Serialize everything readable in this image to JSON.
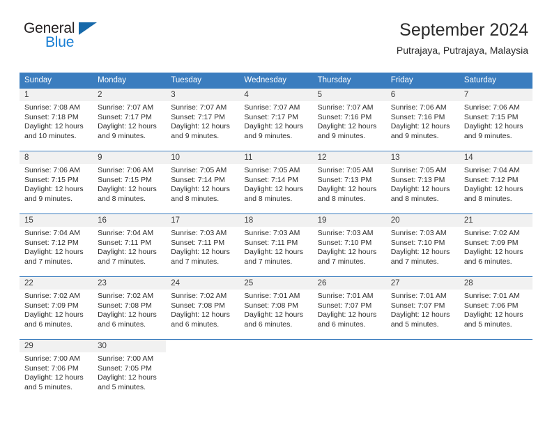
{
  "brand": {
    "name_dark": "General",
    "name_blue": "Blue",
    "accent_blue": "#1a7fd4",
    "triangle_blue": "#1769aa"
  },
  "header": {
    "title": "September 2024",
    "location": "Putrajaya, Putrajaya, Malaysia",
    "header_bg": "#3b7dbf",
    "daynum_bg": "#f1f1f1"
  },
  "weekday_headers": [
    "Sunday",
    "Monday",
    "Tuesday",
    "Wednesday",
    "Thursday",
    "Friday",
    "Saturday"
  ],
  "weeks": [
    {
      "days": [
        {
          "num": "1",
          "sunrise": "Sunrise: 7:08 AM",
          "sunset": "Sunset: 7:18 PM",
          "daylight1": "Daylight: 12 hours",
          "daylight2": "and 10 minutes."
        },
        {
          "num": "2",
          "sunrise": "Sunrise: 7:07 AM",
          "sunset": "Sunset: 7:17 PM",
          "daylight1": "Daylight: 12 hours",
          "daylight2": "and 9 minutes."
        },
        {
          "num": "3",
          "sunrise": "Sunrise: 7:07 AM",
          "sunset": "Sunset: 7:17 PM",
          "daylight1": "Daylight: 12 hours",
          "daylight2": "and 9 minutes."
        },
        {
          "num": "4",
          "sunrise": "Sunrise: 7:07 AM",
          "sunset": "Sunset: 7:17 PM",
          "daylight1": "Daylight: 12 hours",
          "daylight2": "and 9 minutes."
        },
        {
          "num": "5",
          "sunrise": "Sunrise: 7:07 AM",
          "sunset": "Sunset: 7:16 PM",
          "daylight1": "Daylight: 12 hours",
          "daylight2": "and 9 minutes."
        },
        {
          "num": "6",
          "sunrise": "Sunrise: 7:06 AM",
          "sunset": "Sunset: 7:16 PM",
          "daylight1": "Daylight: 12 hours",
          "daylight2": "and 9 minutes."
        },
        {
          "num": "7",
          "sunrise": "Sunrise: 7:06 AM",
          "sunset": "Sunset: 7:15 PM",
          "daylight1": "Daylight: 12 hours",
          "daylight2": "and 9 minutes."
        }
      ]
    },
    {
      "days": [
        {
          "num": "8",
          "sunrise": "Sunrise: 7:06 AM",
          "sunset": "Sunset: 7:15 PM",
          "daylight1": "Daylight: 12 hours",
          "daylight2": "and 9 minutes."
        },
        {
          "num": "9",
          "sunrise": "Sunrise: 7:06 AM",
          "sunset": "Sunset: 7:15 PM",
          "daylight1": "Daylight: 12 hours",
          "daylight2": "and 8 minutes."
        },
        {
          "num": "10",
          "sunrise": "Sunrise: 7:05 AM",
          "sunset": "Sunset: 7:14 PM",
          "daylight1": "Daylight: 12 hours",
          "daylight2": "and 8 minutes."
        },
        {
          "num": "11",
          "sunrise": "Sunrise: 7:05 AM",
          "sunset": "Sunset: 7:14 PM",
          "daylight1": "Daylight: 12 hours",
          "daylight2": "and 8 minutes."
        },
        {
          "num": "12",
          "sunrise": "Sunrise: 7:05 AM",
          "sunset": "Sunset: 7:13 PM",
          "daylight1": "Daylight: 12 hours",
          "daylight2": "and 8 minutes."
        },
        {
          "num": "13",
          "sunrise": "Sunrise: 7:05 AM",
          "sunset": "Sunset: 7:13 PM",
          "daylight1": "Daylight: 12 hours",
          "daylight2": "and 8 minutes."
        },
        {
          "num": "14",
          "sunrise": "Sunrise: 7:04 AM",
          "sunset": "Sunset: 7:12 PM",
          "daylight1": "Daylight: 12 hours",
          "daylight2": "and 8 minutes."
        }
      ]
    },
    {
      "days": [
        {
          "num": "15",
          "sunrise": "Sunrise: 7:04 AM",
          "sunset": "Sunset: 7:12 PM",
          "daylight1": "Daylight: 12 hours",
          "daylight2": "and 7 minutes."
        },
        {
          "num": "16",
          "sunrise": "Sunrise: 7:04 AM",
          "sunset": "Sunset: 7:11 PM",
          "daylight1": "Daylight: 12 hours",
          "daylight2": "and 7 minutes."
        },
        {
          "num": "17",
          "sunrise": "Sunrise: 7:03 AM",
          "sunset": "Sunset: 7:11 PM",
          "daylight1": "Daylight: 12 hours",
          "daylight2": "and 7 minutes."
        },
        {
          "num": "18",
          "sunrise": "Sunrise: 7:03 AM",
          "sunset": "Sunset: 7:11 PM",
          "daylight1": "Daylight: 12 hours",
          "daylight2": "and 7 minutes."
        },
        {
          "num": "19",
          "sunrise": "Sunrise: 7:03 AM",
          "sunset": "Sunset: 7:10 PM",
          "daylight1": "Daylight: 12 hours",
          "daylight2": "and 7 minutes."
        },
        {
          "num": "20",
          "sunrise": "Sunrise: 7:03 AM",
          "sunset": "Sunset: 7:10 PM",
          "daylight1": "Daylight: 12 hours",
          "daylight2": "and 7 minutes."
        },
        {
          "num": "21",
          "sunrise": "Sunrise: 7:02 AM",
          "sunset": "Sunset: 7:09 PM",
          "daylight1": "Daylight: 12 hours",
          "daylight2": "and 6 minutes."
        }
      ]
    },
    {
      "days": [
        {
          "num": "22",
          "sunrise": "Sunrise: 7:02 AM",
          "sunset": "Sunset: 7:09 PM",
          "daylight1": "Daylight: 12 hours",
          "daylight2": "and 6 minutes."
        },
        {
          "num": "23",
          "sunrise": "Sunrise: 7:02 AM",
          "sunset": "Sunset: 7:08 PM",
          "daylight1": "Daylight: 12 hours",
          "daylight2": "and 6 minutes."
        },
        {
          "num": "24",
          "sunrise": "Sunrise: 7:02 AM",
          "sunset": "Sunset: 7:08 PM",
          "daylight1": "Daylight: 12 hours",
          "daylight2": "and 6 minutes."
        },
        {
          "num": "25",
          "sunrise": "Sunrise: 7:01 AM",
          "sunset": "Sunset: 7:08 PM",
          "daylight1": "Daylight: 12 hours",
          "daylight2": "and 6 minutes."
        },
        {
          "num": "26",
          "sunrise": "Sunrise: 7:01 AM",
          "sunset": "Sunset: 7:07 PM",
          "daylight1": "Daylight: 12 hours",
          "daylight2": "and 6 minutes."
        },
        {
          "num": "27",
          "sunrise": "Sunrise: 7:01 AM",
          "sunset": "Sunset: 7:07 PM",
          "daylight1": "Daylight: 12 hours",
          "daylight2": "and 5 minutes."
        },
        {
          "num": "28",
          "sunrise": "Sunrise: 7:01 AM",
          "sunset": "Sunset: 7:06 PM",
          "daylight1": "Daylight: 12 hours",
          "daylight2": "and 5 minutes."
        }
      ]
    },
    {
      "days": [
        {
          "num": "29",
          "sunrise": "Sunrise: 7:00 AM",
          "sunset": "Sunset: 7:06 PM",
          "daylight1": "Daylight: 12 hours",
          "daylight2": "and 5 minutes."
        },
        {
          "num": "30",
          "sunrise": "Sunrise: 7:00 AM",
          "sunset": "Sunset: 7:05 PM",
          "daylight1": "Daylight: 12 hours",
          "daylight2": "and 5 minutes."
        },
        {
          "num": "",
          "sunrise": "",
          "sunset": "",
          "daylight1": "",
          "daylight2": ""
        },
        {
          "num": "",
          "sunrise": "",
          "sunset": "",
          "daylight1": "",
          "daylight2": ""
        },
        {
          "num": "",
          "sunrise": "",
          "sunset": "",
          "daylight1": "",
          "daylight2": ""
        },
        {
          "num": "",
          "sunrise": "",
          "sunset": "",
          "daylight1": "",
          "daylight2": ""
        },
        {
          "num": "",
          "sunrise": "",
          "sunset": "",
          "daylight1": "",
          "daylight2": ""
        }
      ]
    }
  ]
}
